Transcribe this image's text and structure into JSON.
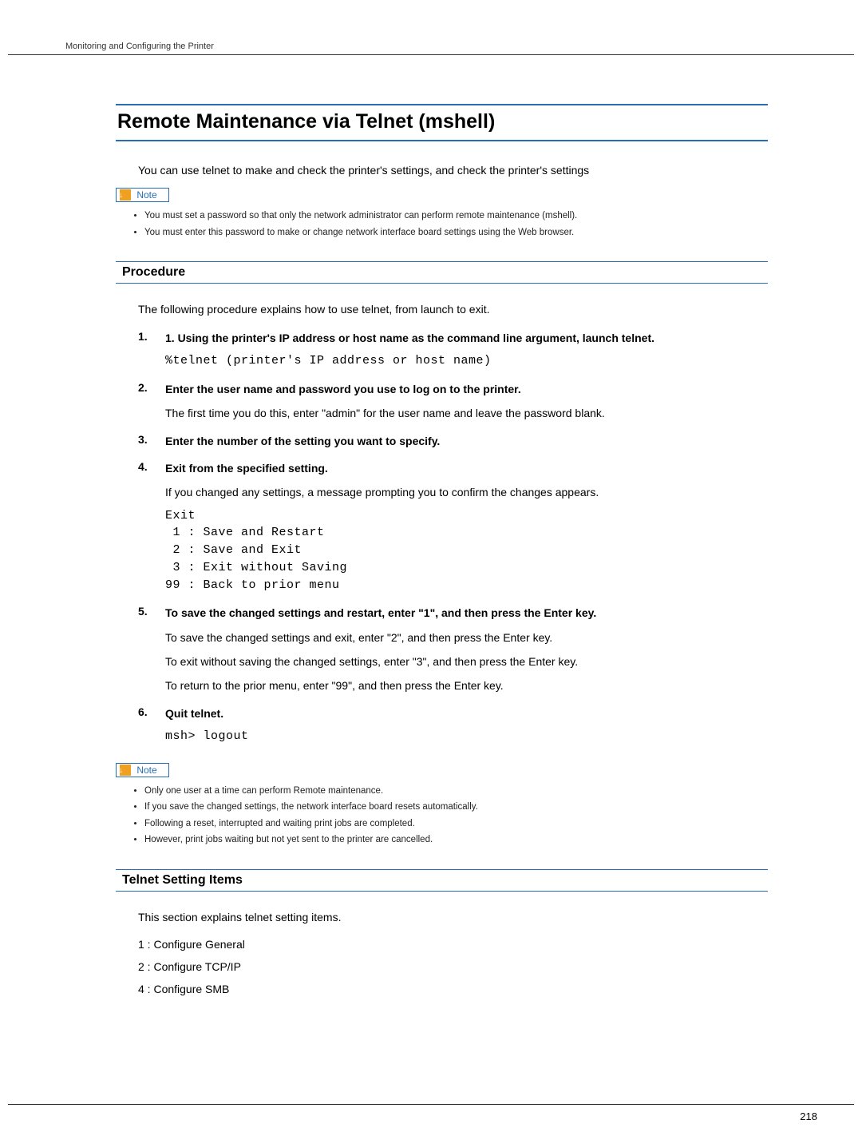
{
  "running_header": "Monitoring and Configuring the Printer",
  "title": "Remote Maintenance via Telnet (mshell)",
  "intro": "You can use telnet to make and check the printer's settings, and check the printer's settings",
  "note_label": "Note",
  "note1_items": [
    "You must set a password so that only the network administrator can perform remote maintenance (mshell).",
    "You must enter this password to make or change network interface board settings using the Web browser."
  ],
  "procedure": {
    "heading": "Procedure",
    "intro": "The following procedure explains how to use telnet, from launch to exit.",
    "steps": [
      {
        "num": "1.",
        "title": "1. Using the printer's IP address or host name as the command line argument, launch telnet.",
        "code": "%telnet (printer's IP address or host name)"
      },
      {
        "num": "2.",
        "title": "Enter the user name and password you use to log on to the printer.",
        "body": "The first time you do this, enter \"admin\" for the user name and leave the password blank."
      },
      {
        "num": "3.",
        "title": "Enter the number of the setting you want to specify."
      },
      {
        "num": "4.",
        "title": "Exit from the specified setting.",
        "body": "If you changed any settings, a message prompting you to confirm the changes appears.",
        "code": "Exit\n 1 : Save and Restart\n 2 : Save and Exit\n 3 : Exit without Saving\n99 : Back to prior menu"
      },
      {
        "num": "5.",
        "title": "To save the changed settings and restart, enter \"1\", and then press the Enter key.",
        "body1": "To save the changed settings and exit, enter \"2\", and then press the Enter key.",
        "body2": "To exit without saving the changed settings, enter \"3\", and then press the Enter key.",
        "body3": "To return to the prior menu, enter \"99\", and then press the Enter key."
      },
      {
        "num": "6.",
        "title": "Quit telnet.",
        "code": "msh> logout"
      }
    ]
  },
  "note2_items": [
    "Only one user at a time can perform Remote maintenance.",
    "If you save the changed settings, the network interface board resets automatically.",
    "Following a reset, interrupted and waiting print jobs are completed.",
    "However, print jobs waiting but not yet sent to the printer are cancelled."
  ],
  "telnet_settings": {
    "heading": "Telnet Setting Items",
    "intro": "This section explains telnet setting items.",
    "items": [
      "1 : Configure General",
      "2 : Configure TCP/IP",
      "4 : Configure SMB"
    ]
  },
  "page_number": "218"
}
